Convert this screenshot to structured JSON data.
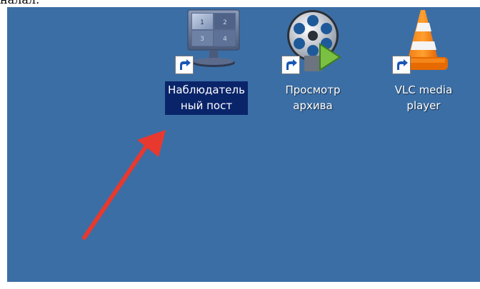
{
  "caption": "налал.",
  "desktop": {
    "background": "#3b6ea5",
    "icons": [
      {
        "label_line1": "Наблюдатель",
        "label_line2": "ный пост",
        "icon": "surveillance-monitor-icon",
        "selected": true
      },
      {
        "label_line1": "Просмотр",
        "label_line2": "архива",
        "icon": "film-reel-play-icon",
        "selected": false
      },
      {
        "label_line1": "VLC media",
        "label_line2": "player",
        "icon": "vlc-cone-icon",
        "selected": false
      }
    ]
  },
  "annotation": {
    "color": "#e8392f",
    "icon": "red-arrow-pointer"
  }
}
